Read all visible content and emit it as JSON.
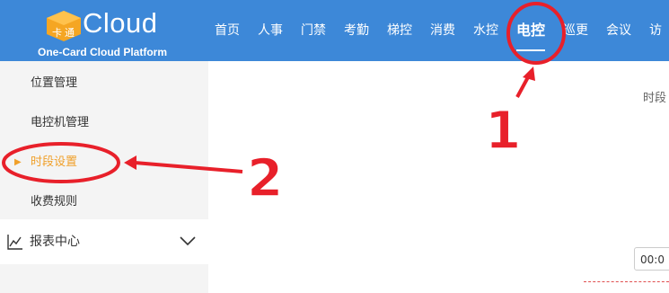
{
  "header": {
    "logo_char": "卡",
    "logo_char2": "通",
    "logo_text": "Cloud",
    "logo_subtitle": "One-Card Cloud Platform",
    "nav": [
      {
        "label": "首页",
        "active": false
      },
      {
        "label": "人事",
        "active": false
      },
      {
        "label": "门禁",
        "active": false
      },
      {
        "label": "考勤",
        "active": false
      },
      {
        "label": "梯控",
        "active": false
      },
      {
        "label": "消费",
        "active": false
      },
      {
        "label": "水控",
        "active": false
      },
      {
        "label": "电控",
        "active": true
      },
      {
        "label": "巡更",
        "active": false
      },
      {
        "label": "会议",
        "active": false
      },
      {
        "label": "访",
        "active": false
      }
    ]
  },
  "sidebar": {
    "items": [
      {
        "label": "位置管理"
      },
      {
        "label": "电控机管理"
      },
      {
        "label": "时段设置",
        "active": true
      },
      {
        "label": "收费规则"
      }
    ],
    "report_center": "报表中心"
  },
  "main": {
    "section_label": "时段",
    "time_value": "00:0"
  },
  "annotations": {
    "marker1": "1",
    "marker2": "2",
    "color": "#e8202a"
  },
  "colors": {
    "header_bg": "#3d88d8",
    "active_side": "#f0a02a",
    "sidebar_bg": "#f4f4f4"
  }
}
